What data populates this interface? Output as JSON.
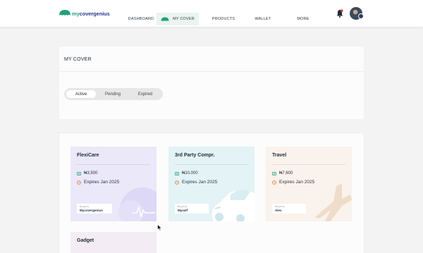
{
  "header": {
    "logo": {
      "prefix": "my",
      "name": "covergenius"
    },
    "nav": [
      {
        "label": "DASHBOARD"
      },
      {
        "label": "MY COVER"
      },
      {
        "label": "PRODUCTS"
      },
      {
        "label": "WALLET"
      },
      {
        "label": "MORE"
      }
    ]
  },
  "my_cover": {
    "title": "MY COVER",
    "tabs": [
      {
        "label": "Active",
        "selected": true
      },
      {
        "label": "Pending",
        "selected": false
      },
      {
        "label": "Expired",
        "selected": false
      }
    ]
  },
  "cards": [
    {
      "title": "FlexiCare",
      "price": "₦3,500",
      "expiry": "Expires Jan 2025",
      "bought_label": "Bought by",
      "bought_by": "Mycovergenius",
      "bg": "#eae8f9"
    },
    {
      "title": "3rd Party Compr.",
      "price": "₦10,000",
      "expiry": "Expires Jan 2025",
      "bought_label": "Bought by",
      "bought_by": "Myself",
      "bg": "#e3f3f6"
    },
    {
      "title": "Travel",
      "price": "₦7,600",
      "expiry": "Expires Jan 2025",
      "bought_label": "Bought by",
      "bought_by": "Alex",
      "bg": "#faf2ec"
    },
    {
      "title": "Gadget",
      "bg": "#f4ecf4"
    }
  ],
  "colors": {
    "accent": "#22a07a",
    "brand_blue": "#2a3b8f",
    "notification": "#e53935"
  }
}
